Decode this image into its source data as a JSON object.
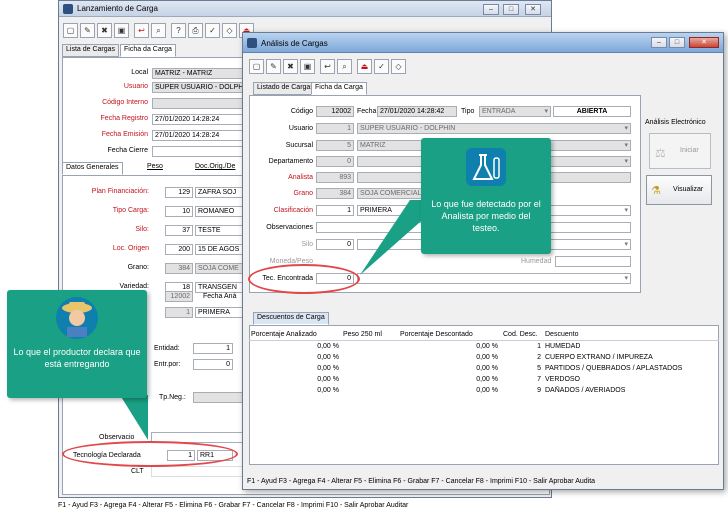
{
  "lanzamiento": {
    "title": "Lanzamiento de Carga",
    "tabs": [
      "Lista de Cargas",
      "Ficha da Carga"
    ],
    "fields": [
      {
        "label": "Local",
        "value": "MATRIZ - MATRIZ"
      },
      {
        "label": "Usuario",
        "value": "SUPER USUARIO - DOLPH"
      },
      {
        "label": "Código Interno",
        "value": ""
      },
      {
        "label": "Fecha Registro",
        "value": "27/01/2020 14:28:24"
      },
      {
        "label": "Fecha Emisión",
        "value": "27/01/2020 14:28:24"
      },
      {
        "label": "Fecha Cierre",
        "value": ""
      }
    ],
    "subtabs": [
      "Datos Generales",
      "Peso",
      "Doc.Orig./De"
    ],
    "rows": [
      {
        "label": "Plan Financiación:",
        "code": "129",
        "value": "ZAFRA SOJ"
      },
      {
        "label": "Tipo Carga:",
        "code": "10",
        "value": "ROMANEO"
      },
      {
        "label": "Silo:",
        "code": "37",
        "value": "TESTE"
      },
      {
        "label": "Loc. Origen",
        "code": "200",
        "value": "15 DE AGOS"
      },
      {
        "label": "Grano:",
        "code": "384",
        "value": "SOJA COME"
      },
      {
        "label": "Variedad:",
        "code": "18",
        "value": "TRANSGEN"
      },
      {
        "label": "",
        "code": "12002",
        "value": "Fecha Aná"
      },
      {
        "label": "",
        "code": "1",
        "value": "PRIMERA"
      }
    ],
    "entidad_label": "Entidad:",
    "entidad_value": "1",
    "entrpor_label": "Entr.por:",
    "entrpor_value": "0",
    "tpneg_label": "Tp.Neg.:",
    "observaciones_label": "Observacio",
    "tecnologia_label": "Tecnología Declarada",
    "tecnologia_code": "1",
    "tecnologia_value": "RR1",
    "clt_label": "CLT",
    "status": "F1 - Ayud   F3 - Agrega F4 - Alterar F5 - Elimina F6 - Grabar F7 - Cancelar F8 - Imprimi F10 - Salir Aprobar    Auditar"
  },
  "analisis": {
    "title": "Análisis de Cargas",
    "tabs": [
      "Listado de Cargas",
      "Ficha da Carga"
    ],
    "codigo_label": "Código",
    "codigo": "12002",
    "fecha_label": "Fecha",
    "fecha": "27/01/2020 14:28:42",
    "tipo_label": "Tipo",
    "tipo": "ENTRADA",
    "estado": "ABIERTA",
    "fields": [
      {
        "label": "Usuario",
        "code": "1",
        "value": "SUPER USUARIO - DOLPHIN",
        "red": false,
        "gray": true
      },
      {
        "label": "Sucursal",
        "code": "5",
        "value": "MATRIZ",
        "red": false,
        "gray": true
      },
      {
        "label": "Departamento",
        "code": "0",
        "value": "",
        "red": false,
        "gray": true
      },
      {
        "label": "Analista",
        "code": "893",
        "value": "",
        "red": true,
        "gray": false
      },
      {
        "label": "Grano",
        "code": "384",
        "value": "SOJA COMERCIAL",
        "red": true,
        "gray": true
      },
      {
        "label": "Clasificación",
        "code": "1",
        "value": "PRIMERA",
        "red": true,
        "gray": false
      },
      {
        "label": "Observaciones",
        "code": "",
        "value": "",
        "red": false,
        "gray": false
      },
      {
        "label": "Silo",
        "code": "0",
        "value": "",
        "red": false,
        "gray": false
      },
      {
        "label": "Moneda/Peso",
        "code": "",
        "value": "",
        "red": false,
        "gray": false
      },
      {
        "label": "Tec. Encontrada",
        "code": "0",
        "value": "",
        "red": false,
        "gray": false
      }
    ],
    "humedad_label": "Humedad",
    "side_title": "Análisis Electrónico",
    "iniciar": "Iniciar",
    "visualizar": "Visualizar",
    "descuentos_tab": "Descuentos de Carga",
    "table_headers": [
      "Porcentaje Analizado",
      "Peso 250 ml",
      "Porcentaje Descontado",
      "Cod. Desc.",
      "Descuento"
    ],
    "table_rows": [
      [
        "0,00 %",
        "",
        "0,00 %",
        "1",
        "HUMEDAD"
      ],
      [
        "0,00 %",
        "",
        "0,00 %",
        "2",
        "CUERPO EXTRANO / IMPUREZA"
      ],
      [
        "0,00 %",
        "",
        "0,00 %",
        "5",
        "PARTIDOS / QUEBRADOS / APLASTADOS"
      ],
      [
        "0,00 %",
        "",
        "0,00 %",
        "7",
        "VERDOSO"
      ],
      [
        "0,00 %",
        "",
        "0,00 %",
        "9",
        "DAÑADOS / AVERIADOS"
      ]
    ],
    "status": "F1 - Ayud          F3 - Agrega F4 - Alterar F5 - Elimina F6 - Grabar F7 - Cancelar F8 - Imprimi F10 - Salir Aprobar    Audita"
  },
  "bubble_analyst": "Lo que fue detectado por el Analista por medio del testeo.",
  "bubble_producer": "Lo que el productor declara que está entregando"
}
